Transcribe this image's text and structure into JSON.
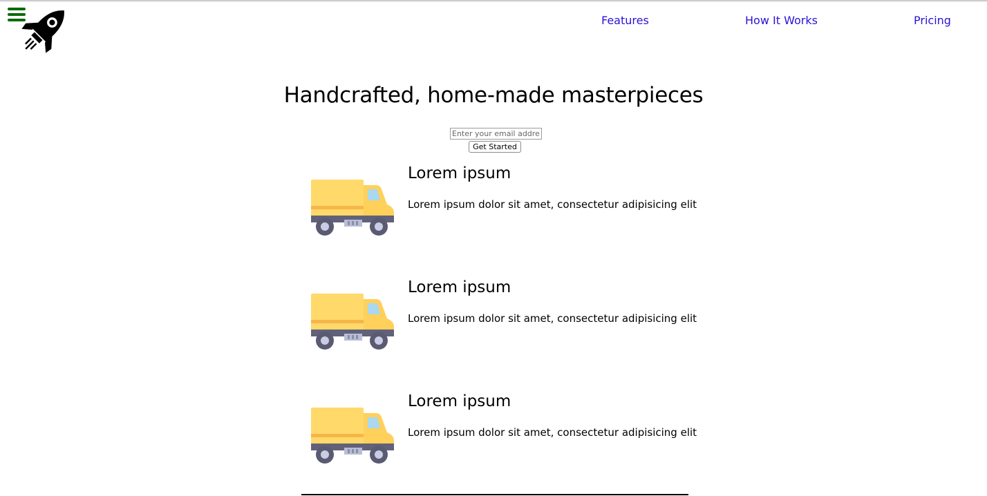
{
  "header": {
    "menu_icon": "hamburger-menu-icon",
    "logo_icon": "rocket-icon",
    "nav": [
      {
        "label": "Features"
      },
      {
        "label": "How It Works"
      },
      {
        "label": "Pricing"
      }
    ],
    "link_color": "#2a12d8",
    "menu_color": "#0c6a0c"
  },
  "hero": {
    "title": "Handcrafted, home-made masterpieces",
    "email_placeholder": "Enter your email address",
    "cta_label": "Get Started"
  },
  "features": [
    {
      "icon": "delivery-truck-icon",
      "title": "Lorem ipsum",
      "text": "Lorem ipsum dolor sit amet, consectetur adipisicing elit"
    },
    {
      "icon": "delivery-truck-icon",
      "title": "Lorem ipsum",
      "text": "Lorem ipsum dolor sit amet, consectetur adipisicing elit"
    },
    {
      "icon": "delivery-truck-icon",
      "title": "Lorem ipsum",
      "text": "Lorem ipsum dolor sit amet, consectetur adipisicing elit"
    }
  ]
}
